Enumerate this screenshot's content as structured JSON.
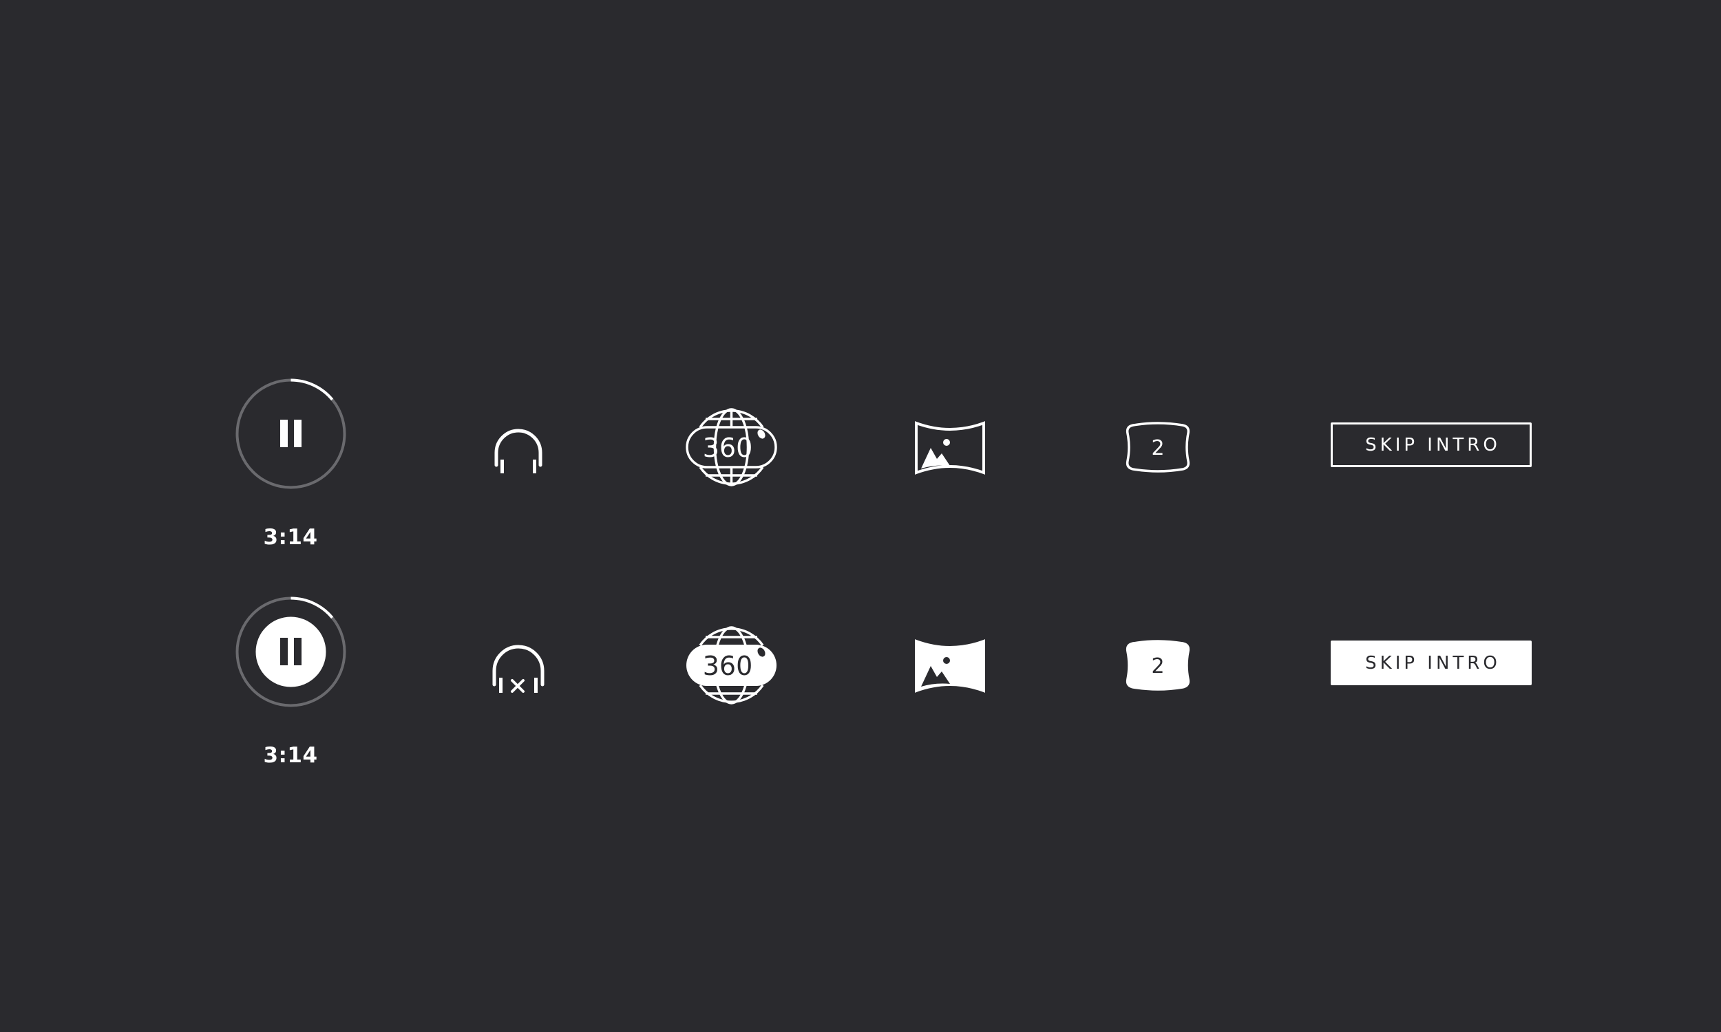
{
  "theme": {
    "background": "#2a2a2e",
    "foreground": "#ffffff",
    "ring_track": "#6a6a6e"
  },
  "rows": {
    "normal": {
      "player": {
        "icon": "pause-icon",
        "timecode": "3:14",
        "progress": 0.14
      },
      "audio": {
        "icon": "headphones-icon"
      },
      "vr": {
        "icon": "globe-360-icon",
        "label": "360"
      },
      "panorama": {
        "icon": "panorama-image-icon"
      },
      "screen": {
        "icon": "curved-screen-icon",
        "label": "2"
      },
      "skip": {
        "label": "SKIP INTRO"
      }
    },
    "active": {
      "player": {
        "icon": "pause-icon",
        "timecode": "3:14",
        "progress": 0.14
      },
      "audio": {
        "icon": "headphones-muted-icon"
      },
      "vr": {
        "icon": "globe-360-icon",
        "label": "360"
      },
      "panorama": {
        "icon": "panorama-image-icon"
      },
      "screen": {
        "icon": "curved-screen-icon",
        "label": "2"
      },
      "skip": {
        "label": "SKIP INTRO"
      }
    }
  }
}
